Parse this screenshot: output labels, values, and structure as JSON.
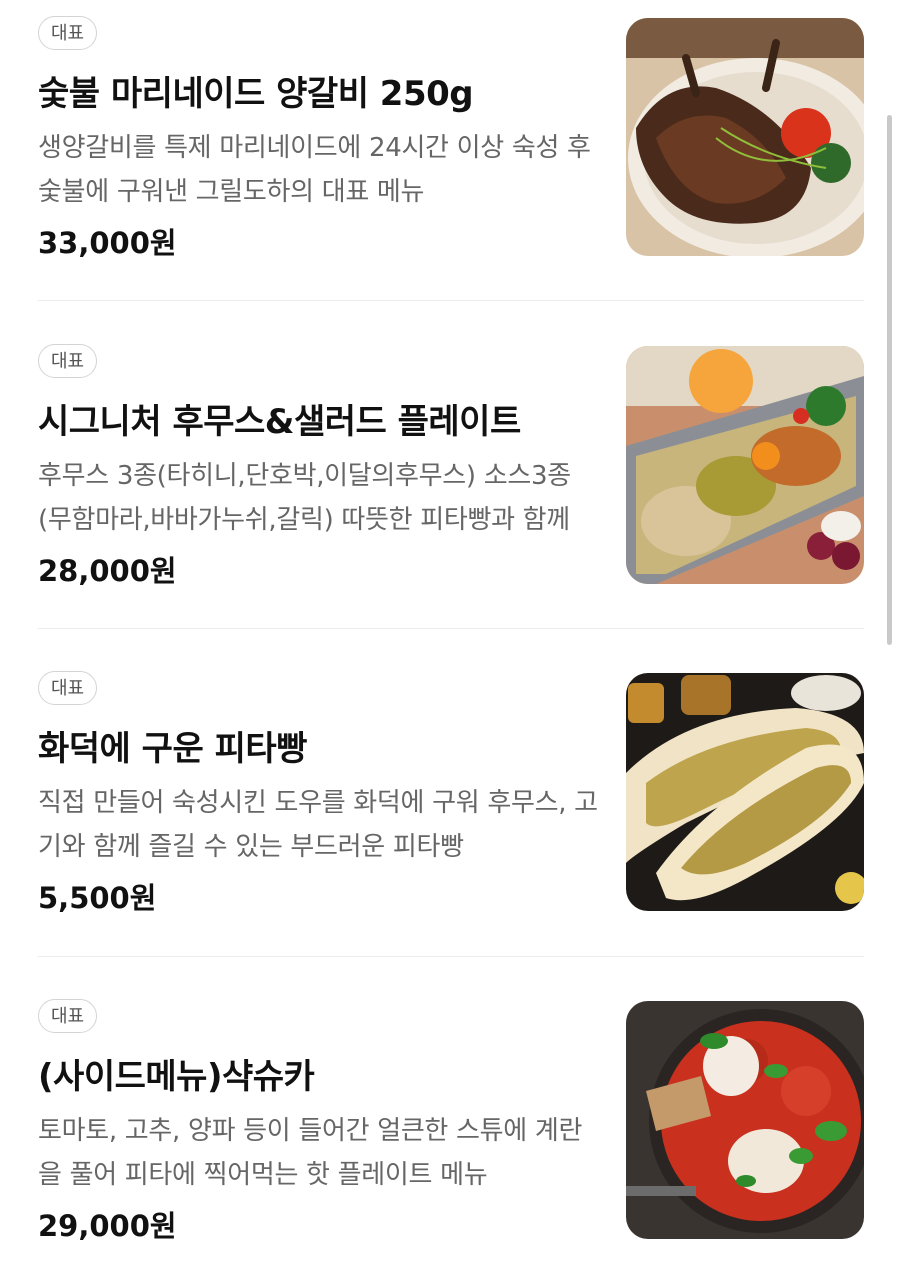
{
  "menu": {
    "items": [
      {
        "badge": "대표",
        "name": "숯불 마리네이드 양갈비 250g",
        "description": "생양갈비를 특제 마리네이드에 24시간 이상 숙성 후 숯불에 구워낸 그릴도하의 대표 메뉴",
        "price": "33,000원",
        "image_icon": "grilled-lamb-ribs-photo"
      },
      {
        "badge": "대표",
        "name": "시그니처 후무스&샐러드 플레이트",
        "description": "후무스 3종(타히니,단호박,이달의후무스) 소스3종(무함마라,바바가누쉬,갈릭) 따뜻한 피타빵과 함께",
        "price": "28,000원",
        "image_icon": "hummus-salad-plate-photo"
      },
      {
        "badge": "대표",
        "name": "화덕에 구운 피타빵",
        "description": "직접 만들어 숙성시킨 도우를 화덕에 구워 후무스, 고기와 함께 즐길 수 있는 부드러운 피타빵",
        "price": "5,500원",
        "image_icon": "pita-bread-photo"
      },
      {
        "badge": "대표",
        "name": "(사이드메뉴)샥슈카",
        "description": "토마토, 고추, 양파 등이 들어간 얼큰한 스튜에 계란을 풀어 피타에 찍어먹는 핫 플레이트 메뉴",
        "price": "29,000원",
        "image_icon": "shakshuka-photo"
      }
    ]
  }
}
